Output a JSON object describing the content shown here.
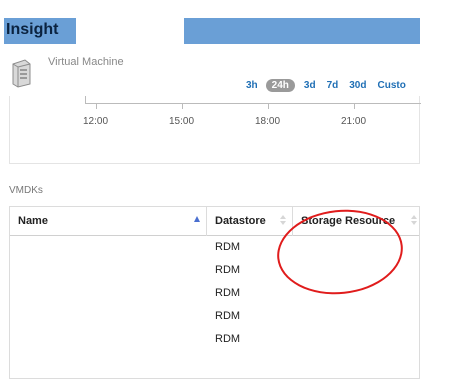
{
  "header": {
    "title": "Insight"
  },
  "object": {
    "type_label": "Virtual Machine"
  },
  "time_ranges": [
    {
      "label": "3h",
      "active": false
    },
    {
      "label": "24h",
      "active": true
    },
    {
      "label": "3d",
      "active": false
    },
    {
      "label": "7d",
      "active": false
    },
    {
      "label": "30d",
      "active": false
    },
    {
      "label": "Custo",
      "active": false
    }
  ],
  "timeline": {
    "ticks": [
      "12:00",
      "15:00",
      "18:00",
      "21:00"
    ]
  },
  "vmdks": {
    "section_label": "VMDKs",
    "columns": [
      "Name",
      "Datastore",
      "Storage Resource"
    ],
    "rows": [
      {
        "name": "",
        "datastore": "RDM",
        "storage_resource": ""
      },
      {
        "name": "",
        "datastore": "RDM",
        "storage_resource": ""
      },
      {
        "name": "",
        "datastore": "RDM",
        "storage_resource": ""
      },
      {
        "name": "",
        "datastore": "RDM",
        "storage_resource": ""
      },
      {
        "name": "",
        "datastore": "RDM",
        "storage_resource": ""
      }
    ]
  },
  "colors": {
    "accent": "#6a9fd6",
    "link": "#1f6fb5",
    "annotation": "#e01c1c"
  }
}
